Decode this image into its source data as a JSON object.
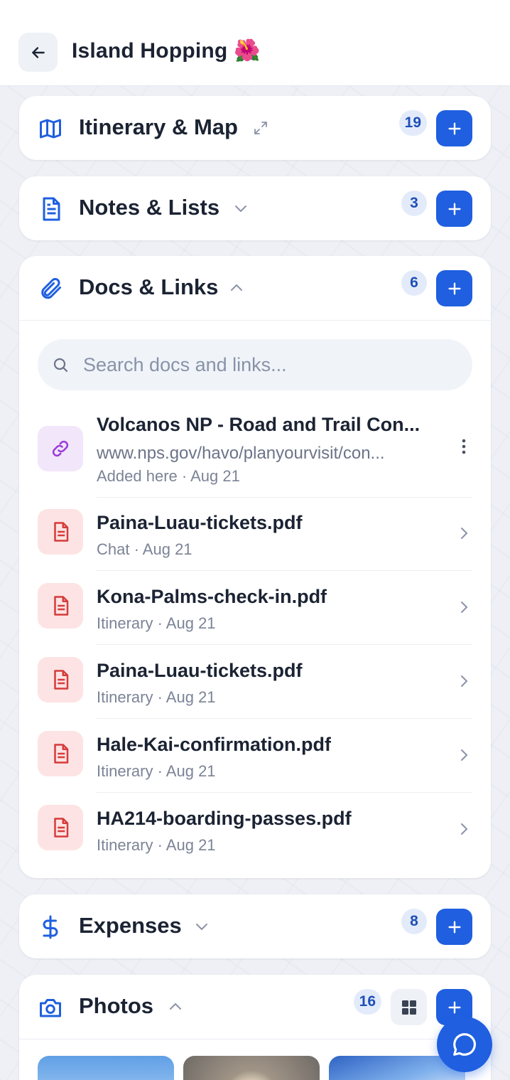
{
  "header": {
    "title": "Island Hopping 🌺"
  },
  "sections": {
    "itinerary": {
      "title": "Itinerary & Map",
      "count": "19"
    },
    "notes": {
      "title": "Notes & Lists",
      "count": "3"
    },
    "docs": {
      "title": "Docs & Links",
      "count": "6",
      "search_placeholder": "Search docs and links...",
      "items": [
        {
          "type": "link",
          "name": "Volcanos NP - Road and Trail Con...",
          "url": "www.nps.gov/havo/planyourvisit/con...",
          "meta": "Added here · Aug 21"
        },
        {
          "type": "pdf",
          "name": "Paina-Luau-tickets.pdf",
          "meta": "Chat · Aug 21"
        },
        {
          "type": "pdf",
          "name": "Kona-Palms-check-in.pdf",
          "meta": "Itinerary · Aug 21"
        },
        {
          "type": "pdf",
          "name": "Paina-Luau-tickets.pdf",
          "meta": "Itinerary · Aug 21"
        },
        {
          "type": "pdf",
          "name": "Hale-Kai-confirmation.pdf",
          "meta": "Itinerary · Aug 21"
        },
        {
          "type": "pdf",
          "name": "HA214-boarding-passes.pdf",
          "meta": "Itinerary · Aug 21"
        }
      ]
    },
    "expenses": {
      "title": "Expenses",
      "count": "8"
    },
    "photos": {
      "title": "Photos",
      "count": "16"
    }
  },
  "colors": {
    "accent": "#1f5fe0",
    "badge_bg": "#e3ebfa",
    "pdf_bg": "#fde3e3",
    "pdf_icon": "#d63b3b",
    "link_bg": "#f2e6fb",
    "link_icon": "#9a3bd6"
  },
  "icons": {
    "back": "arrow-left-icon",
    "itinerary": "map-icon",
    "notes": "document-icon",
    "docs": "paperclip-icon",
    "expenses": "dollar-icon",
    "photos": "camera-icon",
    "search": "search-icon",
    "add": "plus-icon",
    "chat": "chat-bubble-icon"
  }
}
